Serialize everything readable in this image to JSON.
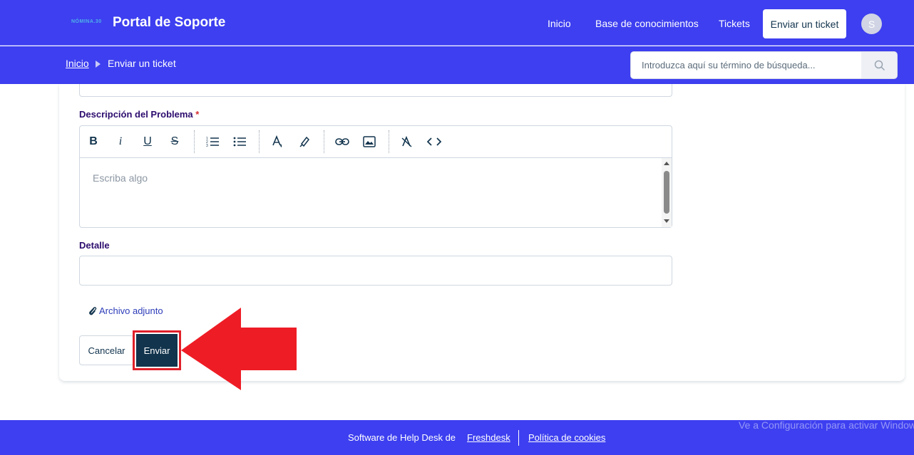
{
  "header": {
    "logo_text": "NÓMINA.30",
    "title": "Portal de Soporte",
    "nav": [
      "Inicio",
      "Base de conocimientos",
      "Tickets"
    ],
    "cta": "Enviar un ticket",
    "avatar_initial": "S"
  },
  "breadcrumb": {
    "home": "Inicio",
    "current": "Enviar un ticket"
  },
  "search": {
    "placeholder": "Introduzca aquí su término de búsqueda..."
  },
  "form": {
    "description_label": "Descripción del Problema",
    "required_mark": "*",
    "editor_placeholder": "Escriba algo",
    "toolbar_icons": [
      "bold-icon",
      "italic-icon",
      "underline-icon",
      "strikethrough-icon",
      "ordered-list-icon",
      "unordered-list-icon",
      "font-color-icon",
      "highlight-icon",
      "link-icon",
      "image-icon",
      "clear-format-icon",
      "code-icon"
    ],
    "detail_label": "Detalle",
    "detail_value": "",
    "attachment_label": "Archivo adjunto",
    "cancel_label": "Cancelar",
    "submit_label": "Enviar"
  },
  "annotation": {
    "highlight_color": "#e0202a"
  },
  "footer": {
    "text": "Software de Help Desk de",
    "link_freshdesk": "Freshdesk",
    "link_cookies": "Política de cookies"
  },
  "watermark": "Ve a Configuración para activar Windows",
  "colors": {
    "brand": "#3d3ff0",
    "primary_button": "#12344d"
  }
}
